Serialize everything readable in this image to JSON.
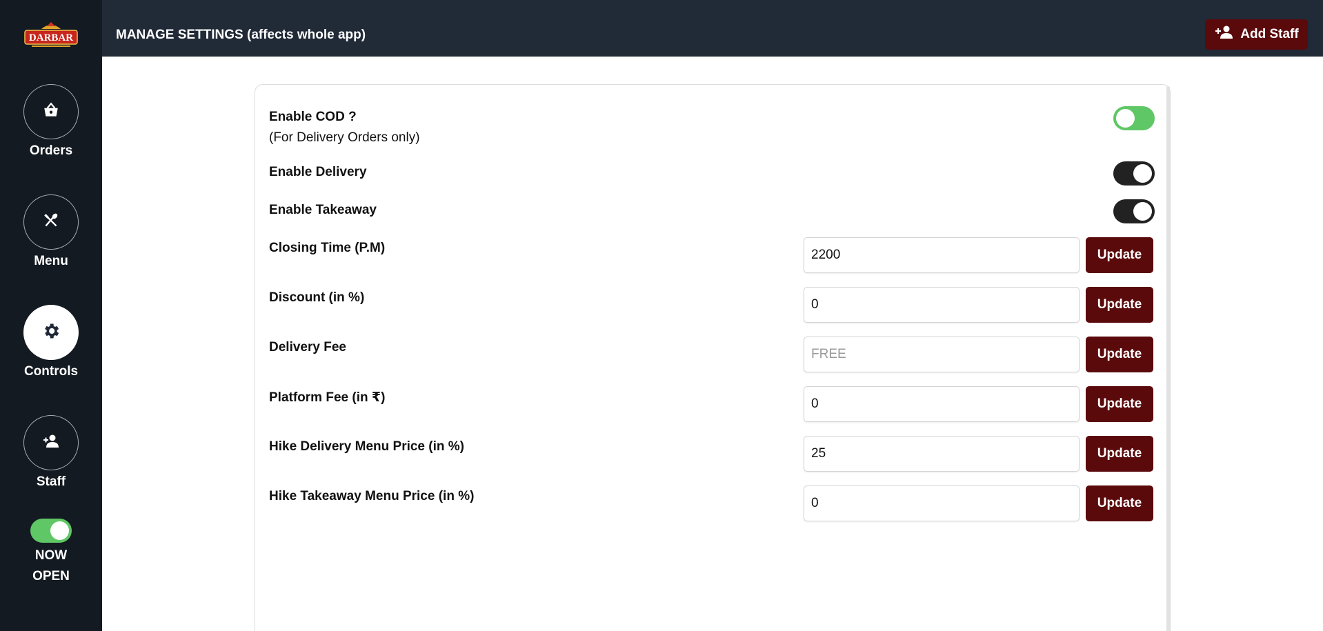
{
  "brand": {
    "logo_text": "DARBAR"
  },
  "sidebar": {
    "items": [
      {
        "label": "Orders",
        "icon": "basket-icon"
      },
      {
        "label": "Menu",
        "icon": "fork-spoon-icon"
      },
      {
        "label": "Controls",
        "icon": "gear-icon",
        "active": true
      },
      {
        "label": "Staff",
        "icon": "person-add-icon"
      }
    ],
    "open_status": {
      "line1": "NOW",
      "line2": "OPEN",
      "on": true
    }
  },
  "header": {
    "title": "MANAGE SETTINGS (affects whole app)",
    "add_staff_label": "Add Staff"
  },
  "settings": {
    "cod": {
      "label": "Enable COD ?",
      "sublabel": "(For Delivery Orders only)",
      "on": true
    },
    "delivery": {
      "label": "Enable Delivery",
      "on": true
    },
    "takeaway": {
      "label": "Enable Takeaway",
      "on": true
    },
    "fields": [
      {
        "label": "Closing Time (P.M)",
        "value": "2200",
        "placeholder": ""
      },
      {
        "label": "Discount (in %)",
        "value": "0",
        "placeholder": ""
      },
      {
        "label": "Delivery Fee",
        "value": "",
        "placeholder": "FREE"
      },
      {
        "label": "Platform Fee (in ₹)",
        "value": "0",
        "placeholder": ""
      },
      {
        "label": "Hike Delivery Menu Price (in %)",
        "value": "25",
        "placeholder": ""
      },
      {
        "label": "Hike Takeaway Menu Price (in %)",
        "value": "0",
        "placeholder": ""
      }
    ],
    "update_label": "Update"
  },
  "colors": {
    "sidebar_bg": "#141a21",
    "header_bg": "#212a37",
    "accent_maroon": "#5b0a0c",
    "toggle_green": "#5fc765",
    "toggle_dark": "#222222"
  }
}
